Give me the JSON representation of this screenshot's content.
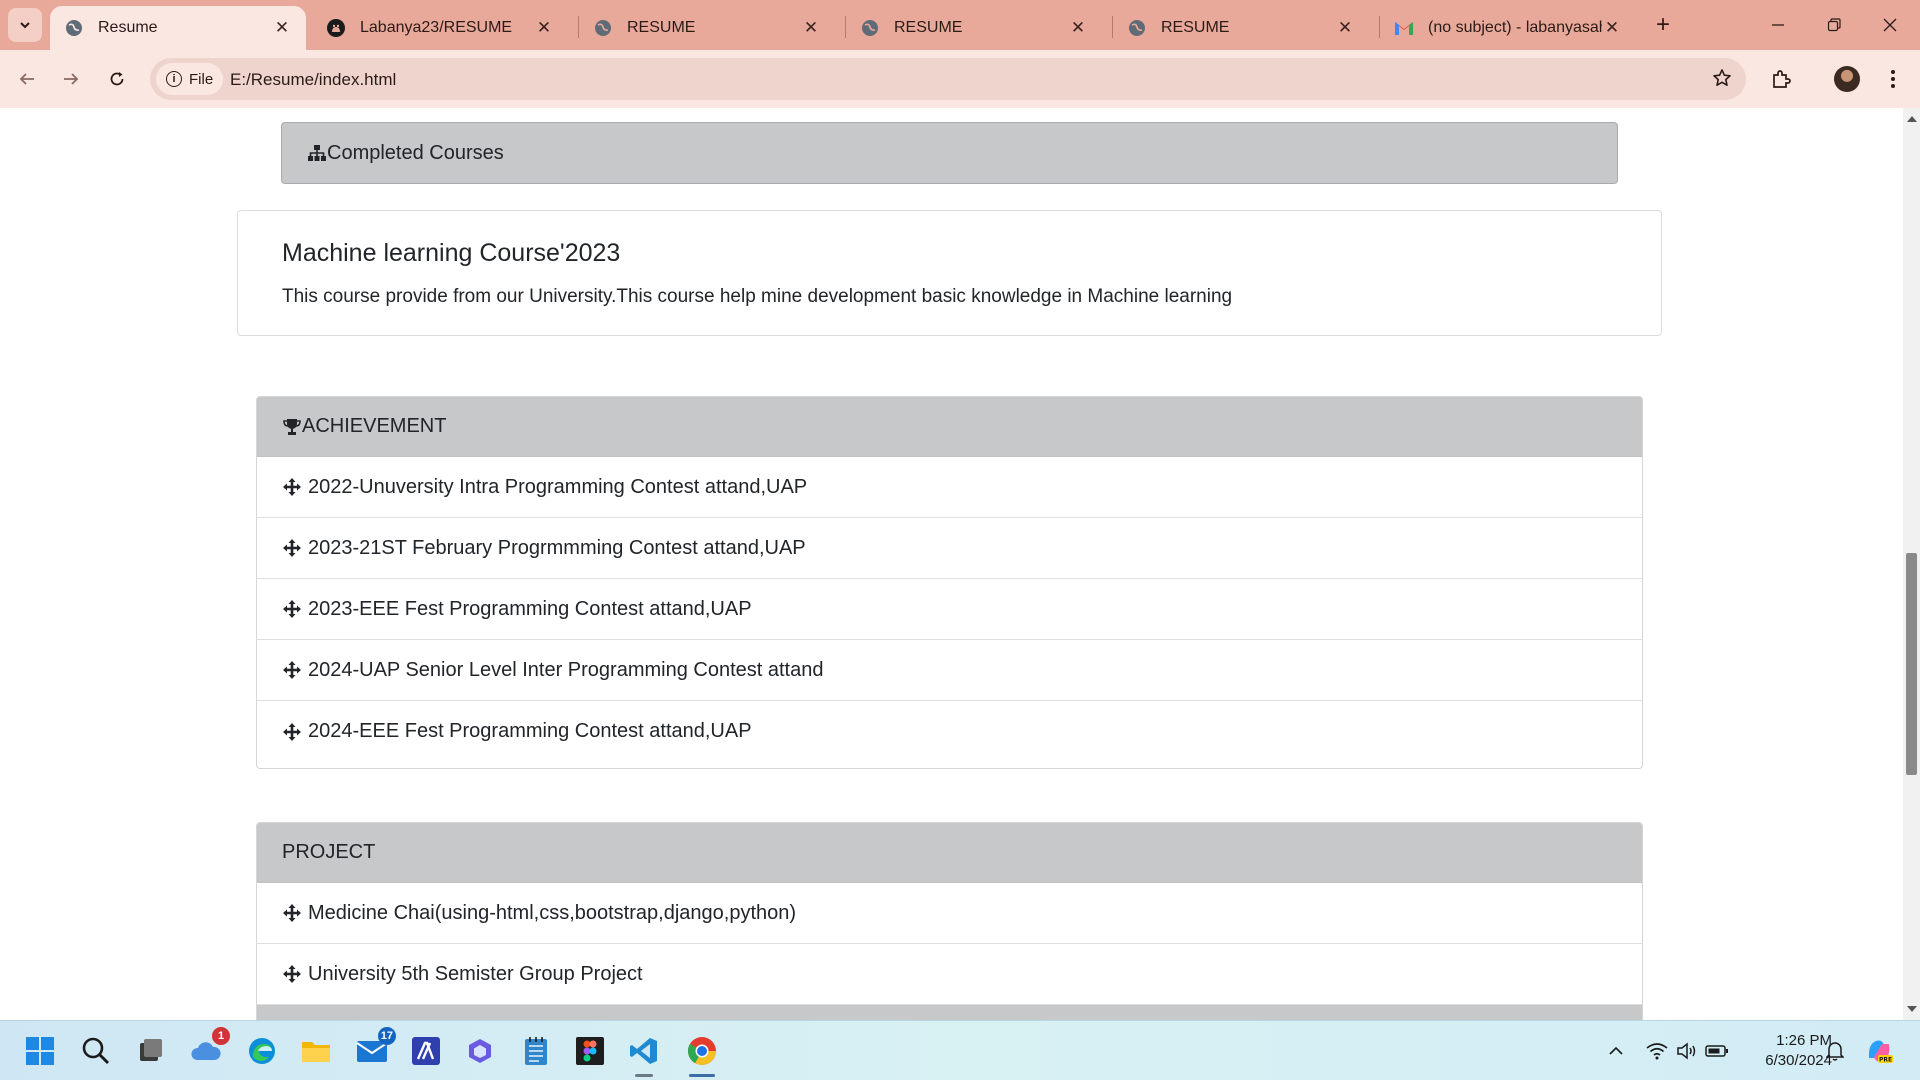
{
  "browser": {
    "tabs": [
      {
        "title": "Resume",
        "active": true,
        "favicon": "globe-icon"
      },
      {
        "title": "Labanya23/RESUME",
        "active": false,
        "favicon": "github-icon"
      },
      {
        "title": "RESUME",
        "active": false,
        "favicon": "globe-icon"
      },
      {
        "title": "RESUME",
        "active": false,
        "favicon": "globe-icon"
      },
      {
        "title": "RESUME",
        "active": false,
        "favicon": "globe-icon"
      },
      {
        "title": "(no subject) - labanyasaha",
        "active": false,
        "favicon": "gmail-icon"
      }
    ],
    "address": {
      "scheme_chip": "File",
      "url": "E:/Resume/index.html"
    },
    "colors": {
      "tabstrip": "#e9a99a",
      "toolbar": "#fbe7e2"
    }
  },
  "page": {
    "courses_header": "Completed Courses",
    "course": {
      "title": "Machine learning Course'2023",
      "description": "This course provide from our University.This course help mine development basic knowledge in Machine learning"
    },
    "achievement": {
      "header": "ACHIEVEMENT",
      "items": [
        "2022-Unuversity Intra Programming Contest attand,UAP",
        "2023-21ST February Progrmmming Contest attand,UAP",
        "2023-EEE Fest Programming Contest attand,UAP",
        "2024-UAP Senior Level Inter Programming Contest attand",
        "2024-EEE Fest Programming Contest attand,UAP"
      ]
    },
    "project": {
      "header": "PROJECT",
      "items": [
        "Medicine Chai(using-html,css,bootstrap,django,python)",
        "University 5th Semister Group Project"
      ]
    }
  },
  "taskbar": {
    "apps": [
      {
        "name": "start-icon"
      },
      {
        "name": "search-icon"
      },
      {
        "name": "task-view-icon"
      },
      {
        "name": "onedrive-icon",
        "badge": "1"
      },
      {
        "name": "edge-icon"
      },
      {
        "name": "file-explorer-icon"
      },
      {
        "name": "mail-icon",
        "badge": "17"
      },
      {
        "name": "math-app-icon"
      },
      {
        "name": "copilot-icon"
      },
      {
        "name": "notepad-icon"
      },
      {
        "name": "figma-icon"
      },
      {
        "name": "vscode-icon"
      },
      {
        "name": "chrome-icon",
        "active": true
      }
    ],
    "time": "1:26 PM",
    "date": "6/30/2024"
  }
}
